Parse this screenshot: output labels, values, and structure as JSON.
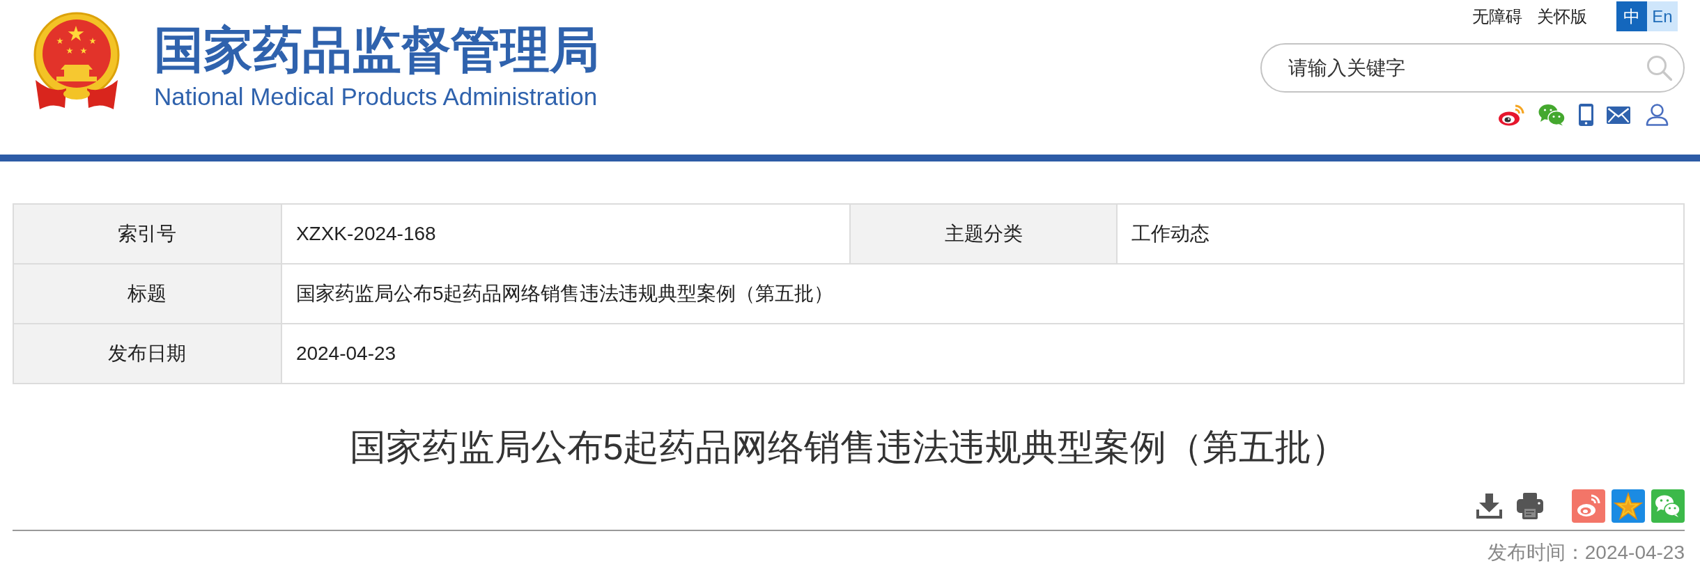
{
  "header": {
    "logo_title": "国家药品监督管理局",
    "logo_subtitle": "National Medical Products Administration",
    "top_links": [
      "无障碍",
      "关怀版"
    ],
    "languages": [
      {
        "label": "中",
        "selected": true
      },
      {
        "label": "En",
        "selected": false
      }
    ],
    "search": {
      "placeholder": "请输入关键字"
    }
  },
  "info_table": {
    "rows": [
      {
        "cells": [
          {
            "label": "索引号",
            "value": "XZXK-2024-168"
          },
          {
            "label": "主题分类",
            "value": "工作动态"
          }
        ]
      },
      {
        "cells": [
          {
            "label": "标题",
            "value": "国家药监局公布5起药品网络销售违法违规典型案例（第五批）"
          }
        ]
      },
      {
        "cells": [
          {
            "label": "发布日期",
            "value": "2024-04-23"
          }
        ]
      }
    ]
  },
  "article": {
    "title": "国家药监局公布5起药品网络销售违法违规典型案例（第五批）",
    "publish_time": "发布时间：2024-04-23"
  }
}
